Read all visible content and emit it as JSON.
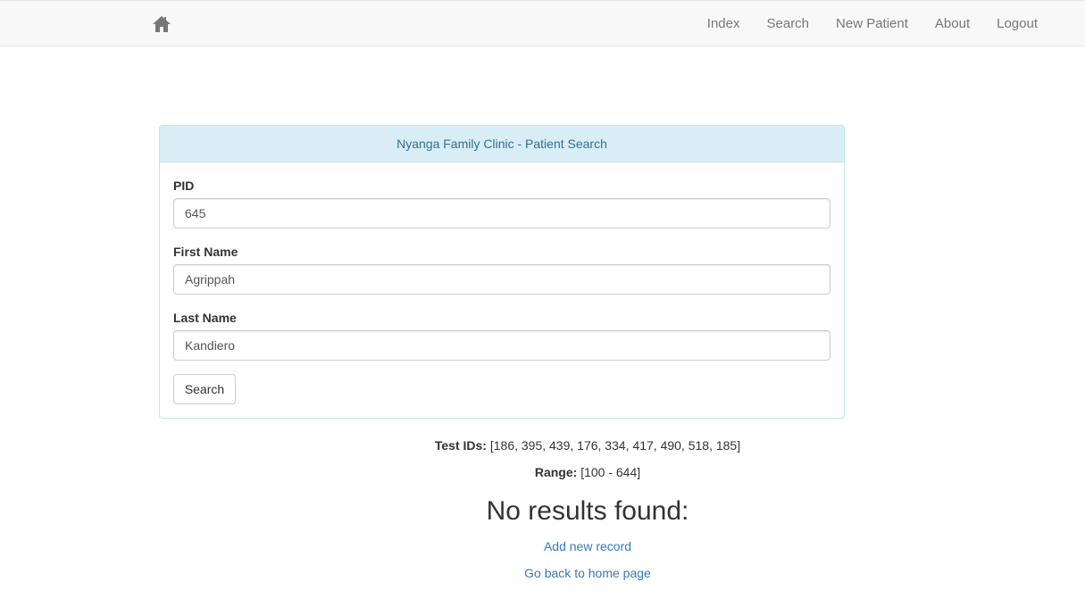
{
  "nav": {
    "home_icon": "home-icon",
    "items": [
      "Index",
      "Search",
      "New Patient",
      "About",
      "Logout"
    ]
  },
  "panel": {
    "heading": "Nyanga Family Clinic - Patient Search",
    "fields": [
      {
        "label": "PID",
        "value": "645"
      },
      {
        "label": "First Name",
        "value": "Agrippah"
      },
      {
        "label": "Last Name",
        "value": "Kandiero"
      }
    ],
    "search_button": "Search"
  },
  "info": {
    "test_ids_label": "Test IDs:",
    "test_ids_value": "[186, 395, 439, 176, 334, 417, 490, 518, 185]",
    "range_label": "Range:",
    "range_value": "[100 - 644]"
  },
  "results": {
    "heading": "No results found:",
    "add_link": "Add new record",
    "home_link": "Go back to home page"
  },
  "colors": {
    "navbar_bg": "#f8f8f8",
    "panel_heading_bg": "#d9edf7",
    "panel_heading_text": "#31708f",
    "link": "#337ab7"
  }
}
